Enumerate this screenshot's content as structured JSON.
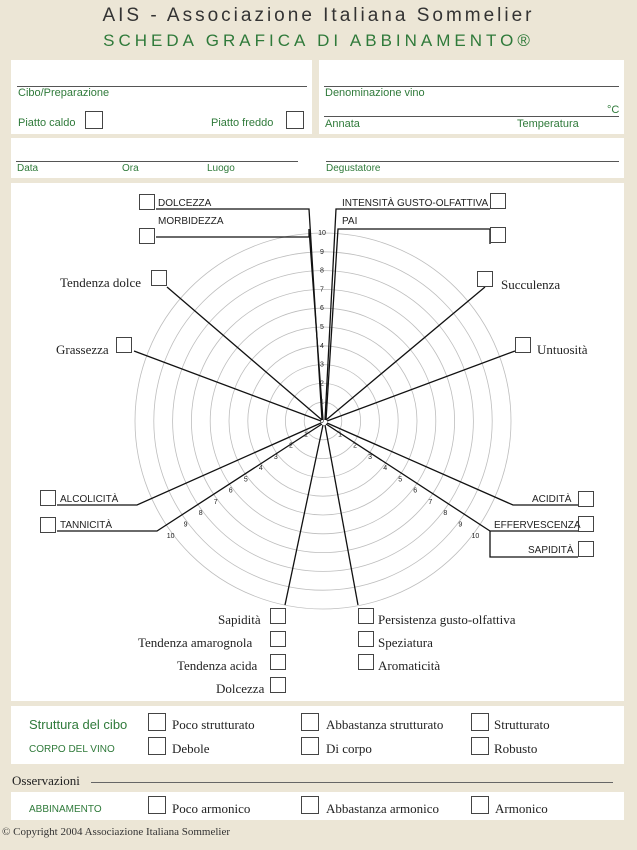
{
  "header": {
    "title": "AIS - Associazione Italiana Sommelier",
    "subtitle": "SCHEDA GRAFICA DI ABBINAMENTO®"
  },
  "food_box": {
    "cibo": "Cibo/Preparazione",
    "piatto_caldo": "Piatto caldo",
    "piatto_freddo": "Piatto freddo"
  },
  "wine_box": {
    "denominazione": "Denominazione vino",
    "celsius": "°C",
    "annata": "Annata",
    "temperatura": "Temperatura"
  },
  "info_box": {
    "data": "Data",
    "ora": "Ora",
    "luogo": "Luogo",
    "degustatore": "Degustatore"
  },
  "chart": {
    "scale": [
      "0",
      "1",
      "2",
      "3",
      "4",
      "5",
      "6",
      "7",
      "8",
      "9",
      "10"
    ],
    "labels": {
      "dolcezza_top": "DOLCEZZA",
      "morbidezza": "MORBIDEZZA",
      "intensita": "INTENSITÀ GUSTO-OLFATTIVA",
      "pai": "PAI",
      "tendenza_dolce": "Tendenza dolce",
      "succulenza": "Succulenza",
      "grassezza": "Grassezza",
      "untuosita": "Untuosità",
      "alcolicita": "ALCOLICITÀ",
      "tannicita": "TANNICITÀ",
      "acidita": "ACIDITÀ",
      "effervescenza": "EFFERVESCENZA",
      "sapidita_right": "SAPIDITÀ",
      "sapidita": "Sapidità",
      "tendenza_amarognola": "Tendenza amarognola",
      "tendenza_acida": "Tendenza acida",
      "dolcezza": "Dolcezza",
      "persistenza": "Persistenza gusto-olfattiva",
      "speziatura": "Speziatura",
      "aromaticita": "Aromaticità"
    }
  },
  "struttura": {
    "label": "Struttura del cibo",
    "opt1": "Poco strutturato",
    "opt2": "Abbastanza strutturato",
    "opt3": "Strutturato"
  },
  "corpo": {
    "label": "CORPO DEL VINO",
    "opt1": "Debole",
    "opt2": "Di corpo",
    "opt3": "Robusto"
  },
  "osservazioni": {
    "label": "Osservazioni"
  },
  "abbinamento": {
    "label": "ABBINAMENTO",
    "opt1": "Poco armonico",
    "opt2": "Abbastanza armonico",
    "opt3": "Armonico"
  },
  "footer": {
    "copyright": "© Copyright 2004 Associazione Italiana Sommelier"
  }
}
